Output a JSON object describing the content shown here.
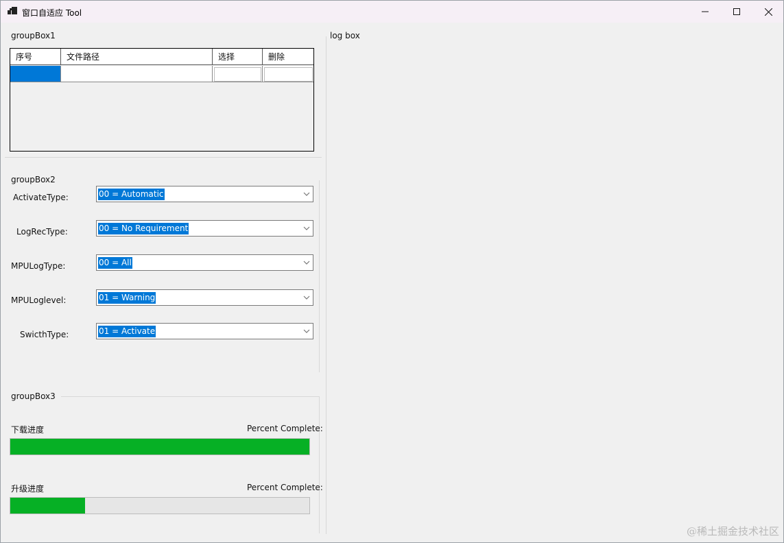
{
  "window": {
    "title": "窗口自适应 Tool"
  },
  "groupBox1": {
    "label": "groupBox1",
    "columns": [
      "序号",
      "文件路径",
      "选择",
      "删除"
    ]
  },
  "groupBox2": {
    "label": "groupBox2",
    "fields": [
      {
        "label": "ActivateType:",
        "value": "00 = Automatic"
      },
      {
        "label": "LogRecType:",
        "value": "00 = No Requirement"
      },
      {
        "label": "MPULogType:",
        "value": "00 = All"
      },
      {
        "label": "MPULoglevel:",
        "value": "01 = Warning"
      },
      {
        "label": "SwicthType:",
        "value": "01 = Activate"
      }
    ]
  },
  "groupBox3": {
    "label": "groupBox3",
    "download": {
      "label": "下载进度",
      "percent_label": "Percent Complete:",
      "progress": 1.0
    },
    "upgrade": {
      "label": "升级进度",
      "percent_label": "Percent Complete:",
      "progress": 0.25
    }
  },
  "logbox": {
    "label": "log box"
  },
  "watermark": "@稀土掘金技术社区",
  "colors": {
    "selection": "#0078d7",
    "progress_fill": "#06b025",
    "title_bg": "#f6eff6"
  }
}
